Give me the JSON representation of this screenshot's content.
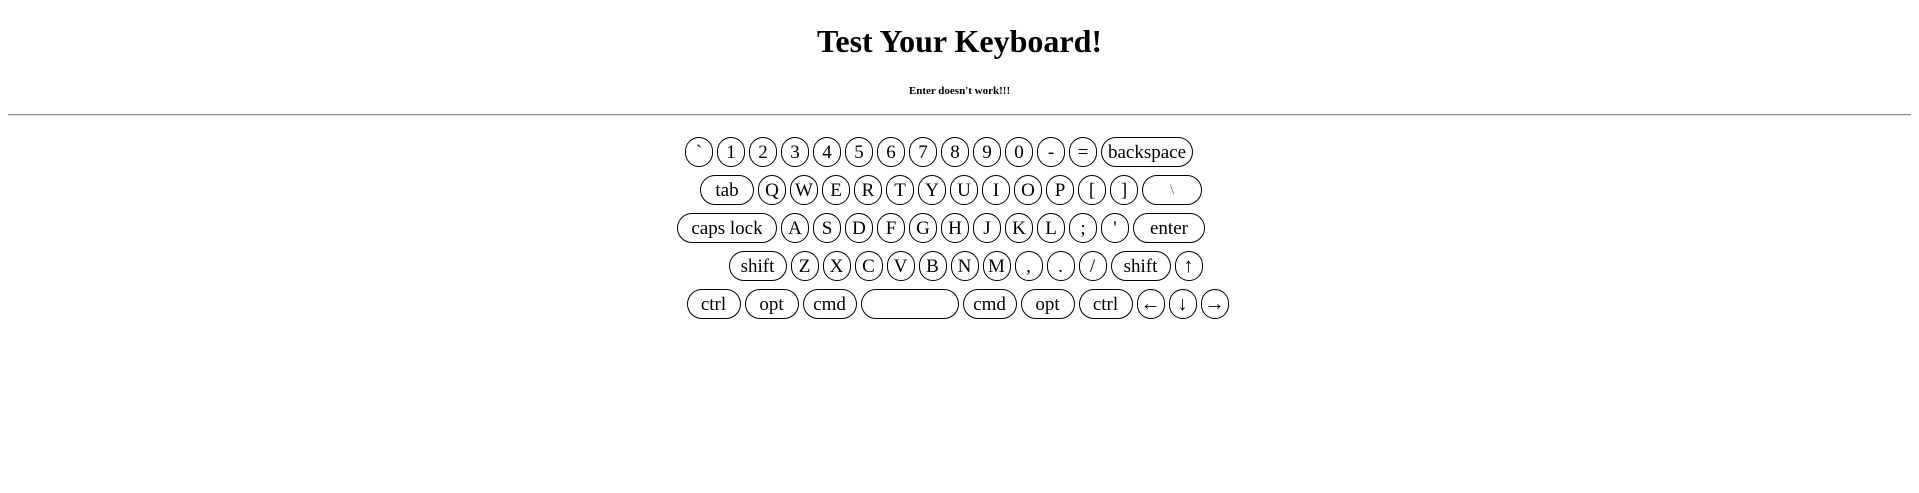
{
  "header": {
    "title": "Test Your Keyboard!",
    "subtitle": "Enter doesn't work!!!"
  },
  "keyboard": {
    "row1": [
      "`",
      "1",
      "2",
      "3",
      "4",
      "5",
      "6",
      "7",
      "8",
      "9",
      "0",
      "-",
      "=",
      "backspace"
    ],
    "row2": [
      "tab",
      "Q",
      "W",
      "E",
      "R",
      "T",
      "Y",
      "U",
      "I",
      "O",
      "P",
      "[",
      "]",
      "\\"
    ],
    "row3": [
      "caps lock",
      "A",
      "S",
      "D",
      "F",
      "G",
      "H",
      "J",
      "K",
      "L",
      ";",
      "'",
      "enter"
    ],
    "row4": [
      "shift",
      "Z",
      "X",
      "C",
      "V",
      "B",
      "N",
      "M",
      ",",
      ".",
      "/",
      "shift",
      "↑"
    ],
    "row5": [
      "ctrl",
      "opt",
      "cmd",
      "",
      "cmd",
      "opt",
      "ctrl",
      "←",
      "↓",
      "→"
    ]
  }
}
